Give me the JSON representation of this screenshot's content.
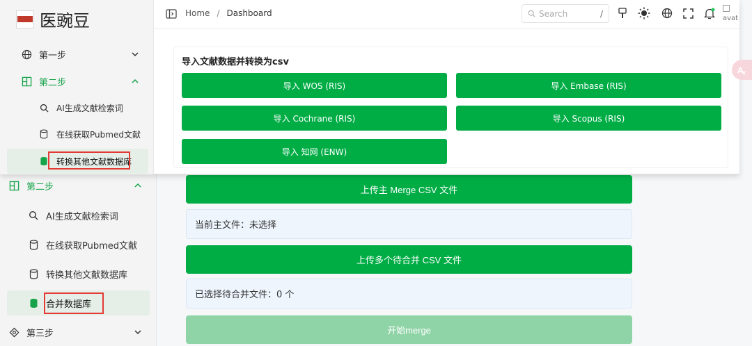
{
  "app": {
    "logo_text": "医豌豆"
  },
  "topbar": {
    "breadcrumb": [
      "Home",
      "Dashboard"
    ],
    "breadcrumb_sep": "/",
    "search_placeholder": "Search",
    "search_shortcut": "/",
    "avatar_alt": "avat"
  },
  "overlay_sidebar": {
    "step1": "第一步",
    "step2": "第二步",
    "items": [
      "AI生成文献检索词",
      "在线获取Pubmed文献",
      "转换其他文献数据库"
    ]
  },
  "base_sidebar": {
    "step2": "第二步",
    "items": [
      "AI生成文献检索词",
      "在线获取Pubmed文献",
      "转换其他文献数据库",
      "合并数据库"
    ],
    "step3": "第三步"
  },
  "import_card": {
    "title": "导入文献数据并转换为csv",
    "buttons": [
      "导入 WOS (RIS)",
      "导入 Embase (RIS)",
      "导入 Cochrane (RIS)",
      "导入 Scopus (RIS)",
      "导入 知网 (ENW)"
    ]
  },
  "merge_card": {
    "upload_main": "上传主 Merge CSV 文件",
    "current_main": "当前主文件：未选择",
    "upload_multi": "上传多个待合并 CSV 文件",
    "selected_files": "已选择待合并文件：0 个",
    "start_merge": "开始merge"
  },
  "colors": {
    "primary": "#00ad45",
    "highlight": "#e53935",
    "active_text": "#16a34a"
  }
}
